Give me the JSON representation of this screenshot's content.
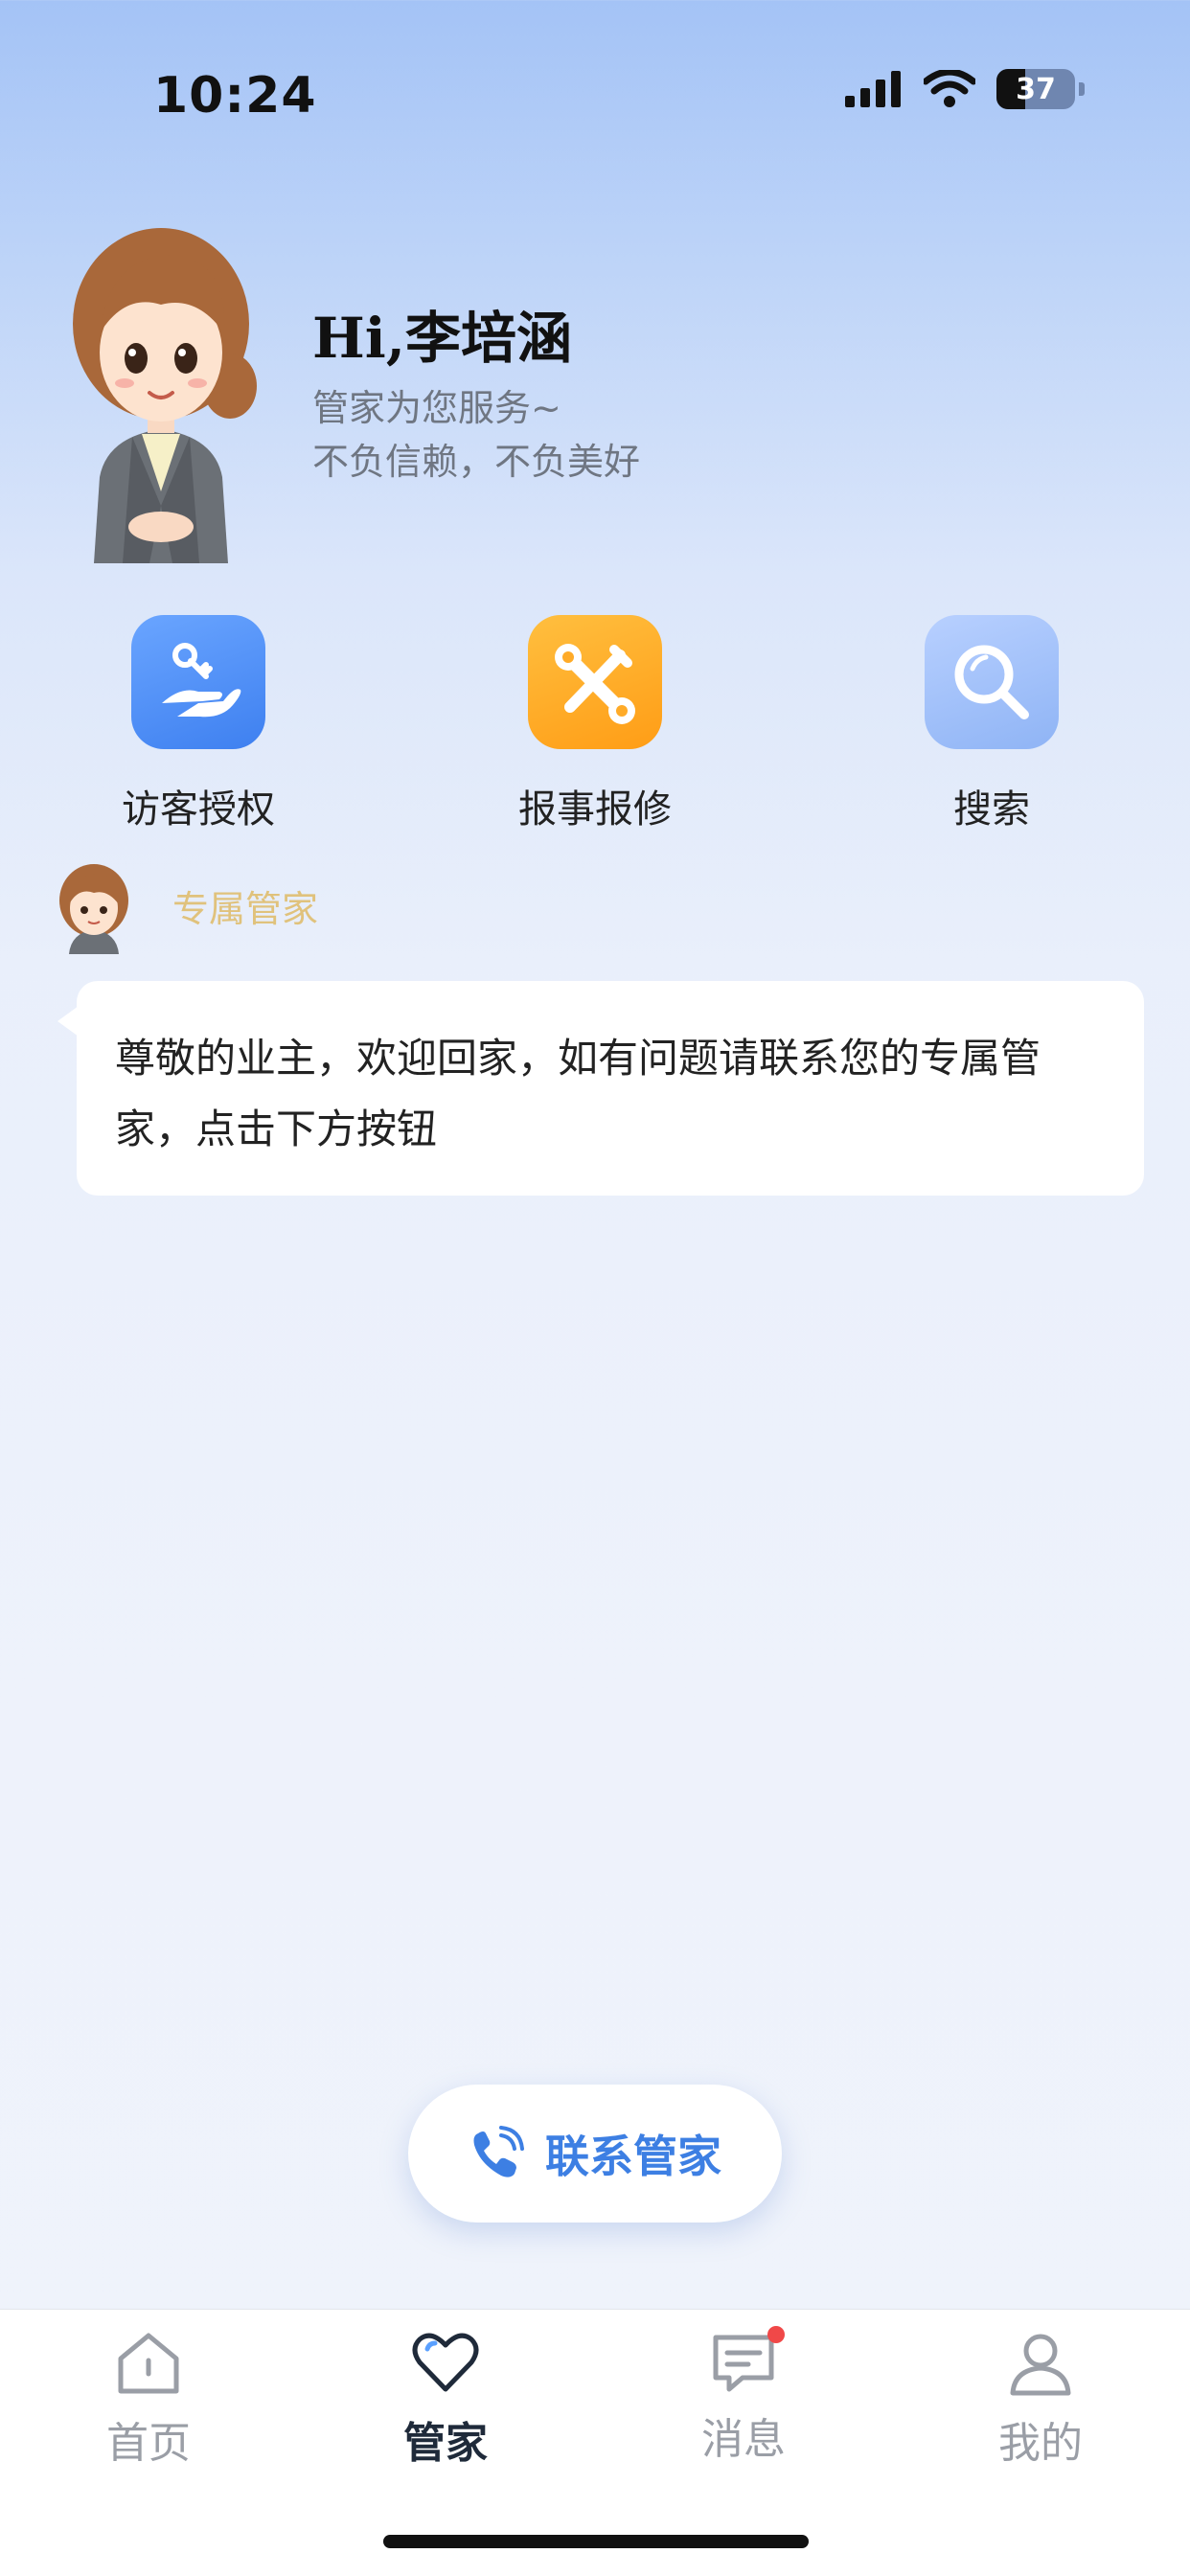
{
  "status_bar": {
    "time": "10:24",
    "battery": "37",
    "battery_level": 0.37
  },
  "greeting": {
    "title": "Hi,李培涵",
    "line1": "管家为您服务~",
    "line2": "不负信赖，不负美好"
  },
  "actions": [
    {
      "label": "访客授权",
      "icon": "hand-key-icon",
      "color": "#4a8cf6"
    },
    {
      "label": "报事报修",
      "icon": "wrench-screwdriver-icon",
      "color": "#ffab28"
    },
    {
      "label": "搜索",
      "icon": "search-icon",
      "color": "#9dbdf7"
    }
  ],
  "butler": {
    "tag": "专属管家"
  },
  "chat": {
    "message": "尊敬的业主，欢迎回家，如有问题请联系您的专属管家，点击下方按钮"
  },
  "contact_button": {
    "label": "联系管家",
    "icon": "phone-icon"
  },
  "tabs": [
    {
      "label": "首页",
      "icon": "home-icon"
    },
    {
      "label": "管家",
      "icon": "heart-icon",
      "active": true
    },
    {
      "label": "消息",
      "icon": "message-icon",
      "badge": true
    },
    {
      "label": "我的",
      "icon": "person-icon"
    }
  ],
  "colors": {
    "accent": "#3d7fe3",
    "butler_tag": "#e0c27c",
    "badge": "#f04848"
  }
}
